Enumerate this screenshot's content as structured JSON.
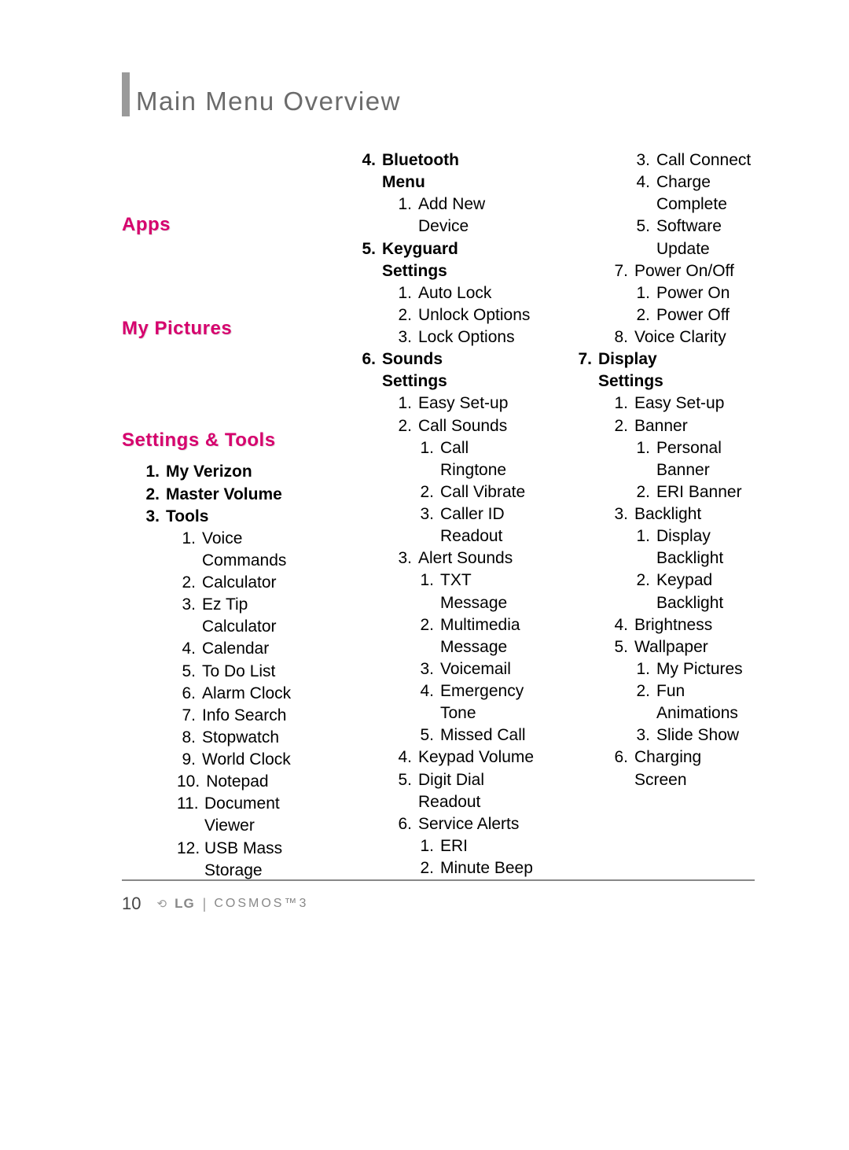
{
  "page_title": "Main Menu Overview",
  "page_number": "10",
  "brand": {
    "logo": "LG",
    "model": "cosmos™3"
  },
  "sections": {
    "apps": "Apps",
    "my_pictures": "My Pictures",
    "settings_tools": "Settings & Tools"
  },
  "col1": {
    "items": [
      {
        "n": "1.",
        "t": "My Verizon",
        "bold": true
      },
      {
        "n": "2.",
        "t": "Master Volume",
        "bold": true
      },
      {
        "n": "3.",
        "t": "Tools",
        "bold": true
      }
    ],
    "tools": [
      {
        "n": "1.",
        "t": "Voice Commands"
      },
      {
        "n": "2.",
        "t": "Calculator"
      },
      {
        "n": "3.",
        "t": "Ez Tip Calculator"
      },
      {
        "n": "4.",
        "t": "Calendar"
      },
      {
        "n": "5.",
        "t": "To Do List"
      },
      {
        "n": "6.",
        "t": "Alarm Clock"
      },
      {
        "n": "7.",
        "t": "Info Search"
      },
      {
        "n": "8.",
        "t": "Stopwatch"
      },
      {
        "n": "9.",
        "t": "World Clock"
      },
      {
        "n": "10.",
        "t": "Notepad"
      },
      {
        "n": "11.",
        "t": "Document Viewer"
      },
      {
        "n": "12.",
        "t": "USB Mass Storage"
      }
    ]
  },
  "col2": [
    {
      "lvl": 1,
      "n": "4.",
      "t": "Bluetooth Menu",
      "bold": true
    },
    {
      "lvl": 2,
      "n": "1.",
      "t": "Add New Device"
    },
    {
      "lvl": 1,
      "n": "5.",
      "t": "Keyguard Settings",
      "bold": true
    },
    {
      "lvl": 2,
      "n": "1.",
      "t": "Auto Lock"
    },
    {
      "lvl": 2,
      "n": "2.",
      "t": "Unlock Options"
    },
    {
      "lvl": 2,
      "n": "3.",
      "t": "Lock Options"
    },
    {
      "lvl": 1,
      "n": "6.",
      "t": "Sounds Settings",
      "bold": true
    },
    {
      "lvl": 2,
      "n": "1.",
      "t": "Easy Set-up"
    },
    {
      "lvl": 2,
      "n": "2.",
      "t": "Call Sounds"
    },
    {
      "lvl": 3,
      "n": "1.",
      "t": "Call Ringtone"
    },
    {
      "lvl": 3,
      "n": "2.",
      "t": "Call Vibrate"
    },
    {
      "lvl": 3,
      "n": "3.",
      "t": "Caller ID Readout"
    },
    {
      "lvl": 2,
      "n": "3.",
      "t": "Alert Sounds"
    },
    {
      "lvl": 3,
      "n": "1.",
      "t": "TXT Message"
    },
    {
      "lvl": 3,
      "n": "2.",
      "t": "Multimedia Message"
    },
    {
      "lvl": 3,
      "n": "3.",
      "t": "Voicemail"
    },
    {
      "lvl": 3,
      "n": "4.",
      "t": "Emergency Tone"
    },
    {
      "lvl": 3,
      "n": "5.",
      "t": "Missed Call"
    },
    {
      "lvl": 2,
      "n": "4.",
      "t": "Keypad Volume"
    },
    {
      "lvl": 2,
      "n": "5.",
      "t": "Digit Dial Readout"
    },
    {
      "lvl": 2,
      "n": "6.",
      "t": "Service Alerts"
    },
    {
      "lvl": 3,
      "n": "1.",
      "t": "ERI"
    },
    {
      "lvl": 3,
      "n": "2.",
      "t": "Minute Beep"
    }
  ],
  "col3": [
    {
      "lvl": 3,
      "n": "3.",
      "t": "Call Connect"
    },
    {
      "lvl": 3,
      "n": "4.",
      "t": "Charge Complete"
    },
    {
      "lvl": 3,
      "n": "5.",
      "t": "Software Update"
    },
    {
      "lvl": 2,
      "n": "7.",
      "t": "Power On/Off"
    },
    {
      "lvl": 3,
      "n": "1.",
      "t": "Power On"
    },
    {
      "lvl": 3,
      "n": "2.",
      "t": "Power Off"
    },
    {
      "lvl": 2,
      "n": "8.",
      "t": "Voice Clarity"
    },
    {
      "lvl": 1,
      "n": "7.",
      "t": "Display Settings",
      "bold": true
    },
    {
      "lvl": 2,
      "n": "1.",
      "t": "Easy Set-up"
    },
    {
      "lvl": 2,
      "n": "2.",
      "t": "Banner"
    },
    {
      "lvl": 3,
      "n": "1.",
      "t": "Personal Banner"
    },
    {
      "lvl": 3,
      "n": "2.",
      "t": "ERI Banner"
    },
    {
      "lvl": 2,
      "n": "3.",
      "t": "Backlight"
    },
    {
      "lvl": 3,
      "n": "1.",
      "t": "Display Backlight"
    },
    {
      "lvl": 3,
      "n": "2.",
      "t": "Keypad Backlight"
    },
    {
      "lvl": 2,
      "n": "4.",
      "t": "Brightness"
    },
    {
      "lvl": 2,
      "n": "5.",
      "t": "Wallpaper"
    },
    {
      "lvl": 3,
      "n": "1.",
      "t": "My Pictures"
    },
    {
      "lvl": 3,
      "n": "2.",
      "t": "Fun Animations"
    },
    {
      "lvl": 3,
      "n": "3.",
      "t": "Slide Show"
    },
    {
      "lvl": 2,
      "n": "6.",
      "t": "Charging Screen"
    }
  ]
}
